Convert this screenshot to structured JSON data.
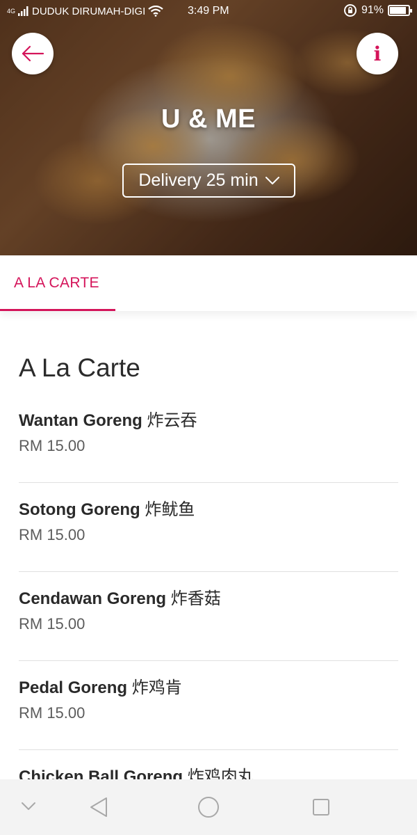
{
  "status_bar": {
    "network": "4G",
    "carrier": "DUDUK DIRUMAH-DIGI",
    "time": "3:49 PM",
    "battery_percent": "91%",
    "battery_level": 0.91
  },
  "header": {
    "restaurant_name": "U & ME",
    "delivery_label": "Delivery 25 min",
    "back_icon": "arrow-left-icon",
    "info_icon": "info-icon",
    "info_glyph": "i"
  },
  "tabs": [
    {
      "label": "A LA CARTE",
      "active": true
    }
  ],
  "menu": {
    "section_title": "A La Carte",
    "items": [
      {
        "name": "Wantan Goreng",
        "name_cn": "炸云吞",
        "price": "RM 15.00"
      },
      {
        "name": "Sotong Goreng",
        "name_cn": "炸鱿鱼",
        "price": "RM 15.00"
      },
      {
        "name": "Cendawan Goreng",
        "name_cn": "炸香菇",
        "price": "RM 15.00"
      },
      {
        "name": "Pedal Goreng",
        "name_cn": "炸鸡肯",
        "price": "RM 15.00"
      },
      {
        "name": "Chicken Ball Goreng",
        "name_cn": "炸鸡肉丸",
        "price": ""
      }
    ]
  },
  "colors": {
    "accent": "#d4145a",
    "text": "#2a2a2a",
    "price": "#5c5c5c"
  }
}
